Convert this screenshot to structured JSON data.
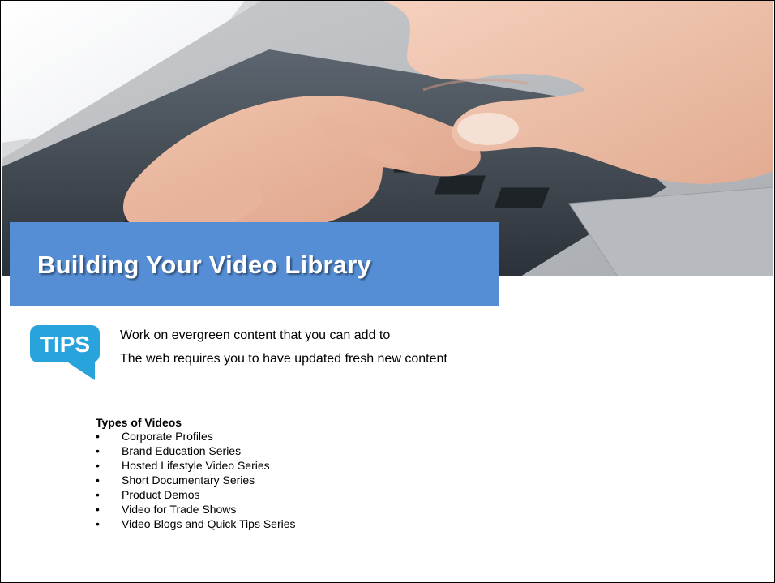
{
  "slide": {
    "title": "Building Your Video Library",
    "title_band_color": "#558ed5",
    "hero_image": "hands-typing-on-keyboard-photo"
  },
  "tips": {
    "badge_text": "TIPS",
    "badge_color": "#29a3dc",
    "lines": [
      "Work on evergreen content that you can add to",
      "The web requires you to have updated fresh new content"
    ]
  },
  "types": {
    "heading": "Types of Videos",
    "bullet": "•",
    "items": [
      "Corporate Profiles",
      "Brand Education Series",
      "Hosted Lifestyle Video Series",
      "Short Documentary Series",
      "Product Demos",
      "Video for Trade Shows",
      "Video Blogs and Quick Tips Series"
    ]
  }
}
